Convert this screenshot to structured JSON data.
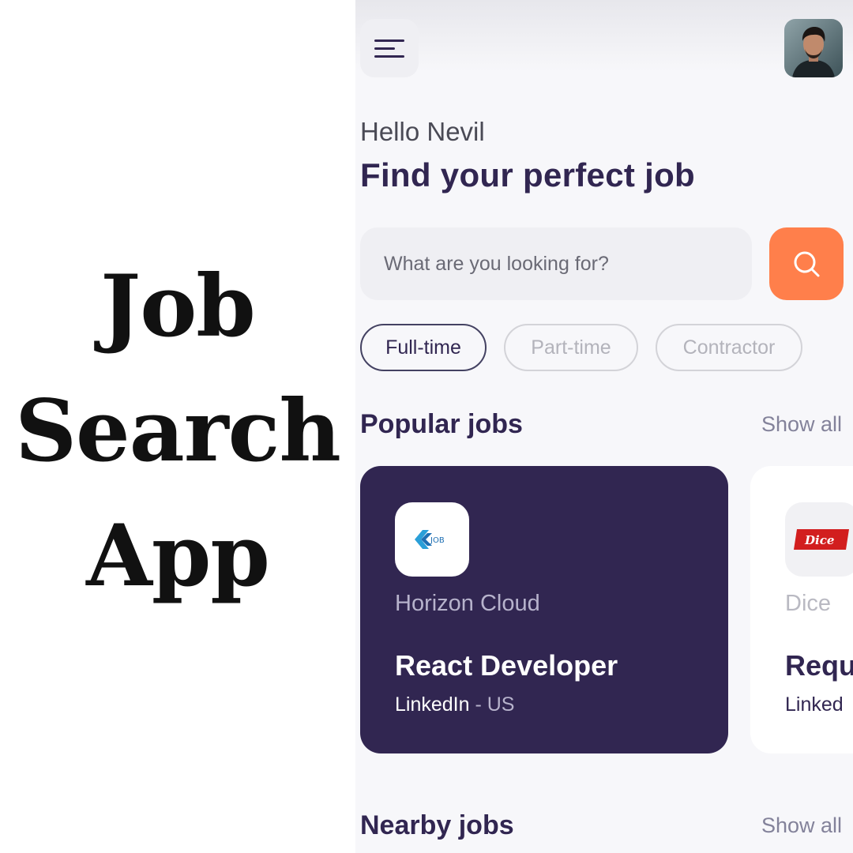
{
  "promo": {
    "lines": [
      "Job",
      "Search",
      "App"
    ]
  },
  "header": {
    "menu_icon": "menu-icon",
    "avatar_icon": "avatar"
  },
  "welcome": {
    "greeting": "Hello Nevil",
    "headline": "Find your perfect job"
  },
  "search": {
    "placeholder": "What are you looking for?",
    "button_icon": "search-icon"
  },
  "job_types": {
    "selected": "Full-time",
    "items": [
      {
        "label": "Full-time"
      },
      {
        "label": "Part-time"
      },
      {
        "label": "Contractor"
      }
    ]
  },
  "popular": {
    "title": "Popular jobs",
    "show_all": "Show all",
    "cards": [
      {
        "company": "Horizon Cloud",
        "logo_text": "JOB",
        "title": "React Developer",
        "publisher": "LinkedIn",
        "separator": " - ",
        "location": "US"
      },
      {
        "company": "Dice",
        "logo_text": "Dice",
        "title": "Requ",
        "publisher": "Linked"
      }
    ]
  },
  "nearby": {
    "title": "Nearby jobs",
    "show_all": "Show all"
  },
  "colors": {
    "primary": "#312651",
    "accent": "#ff7f4b",
    "background": "#f7f7fa"
  }
}
